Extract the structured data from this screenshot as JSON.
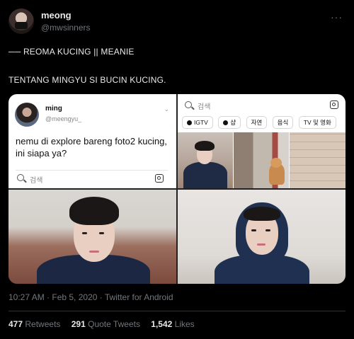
{
  "tweet": {
    "author_name": "meong",
    "author_handle": "@mwsinners",
    "more_label": "···",
    "text_line1": "── REOMA KUCING || MEANIE",
    "text_line2": "TENTANG MINGYU SI BUCIN KUCING.",
    "timestamp": "10:27 AM · Feb 5, 2020 · Twitter for Android"
  },
  "embedded": {
    "author_name": "ming",
    "author_handle": "@meengyu_",
    "text": "nemu di explore bareng foto2 kucing, ini siapa ya?",
    "search_placeholder": "검색"
  },
  "explore": {
    "search_placeholder": "검색",
    "chips": [
      "IGTV",
      "샵",
      "자연",
      "음식",
      "TV 및 영화"
    ]
  },
  "stats": {
    "retweets_count": "477",
    "retweets_label": "Retweets",
    "quotes_count": "291",
    "quotes_label": "Quote Tweets",
    "likes_count": "1,542",
    "likes_label": "Likes"
  },
  "colors": {
    "background": "#000000",
    "text_primary": "#e7e9ea",
    "text_secondary": "#71767b",
    "divider": "#2f3336"
  }
}
